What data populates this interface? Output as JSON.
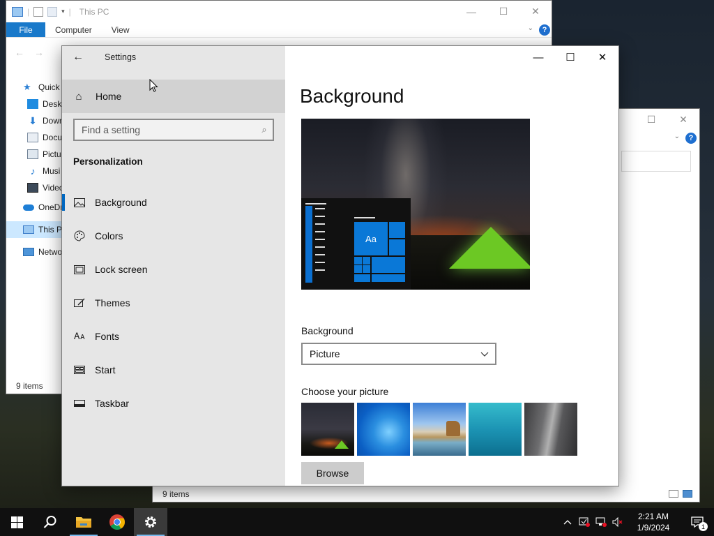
{
  "explorer1": {
    "title": "This PC",
    "ribbon": [
      "File",
      "Computer",
      "View"
    ],
    "tree": [
      {
        "label": "Quick",
        "icon": "star-icon",
        "sub": false
      },
      {
        "label": "Deskt",
        "icon": "desktop-folder-icon",
        "sub": true
      },
      {
        "label": "Down",
        "icon": "download-icon",
        "sub": true
      },
      {
        "label": "Docu",
        "icon": "document-icon",
        "sub": true
      },
      {
        "label": "Pictu",
        "icon": "pictures-icon",
        "sub": true
      },
      {
        "label": "Musi",
        "icon": "music-icon",
        "sub": true
      },
      {
        "label": "Video",
        "icon": "video-icon",
        "sub": true
      },
      {
        "label": "OneDr",
        "icon": "cloud-icon",
        "sub": false
      },
      {
        "label": "This PC",
        "icon": "computer-icon",
        "sub": false
      },
      {
        "label": "Netwo",
        "icon": "network-icon",
        "sub": false
      }
    ],
    "status": "9 items"
  },
  "explorer2": {
    "status": "9 items"
  },
  "settings": {
    "app_title": "Settings",
    "home_label": "Home",
    "search_placeholder": "Find a setting",
    "section_title": "Personalization",
    "nav": [
      {
        "label": "Background",
        "icon": "picture-icon"
      },
      {
        "label": "Colors",
        "icon": "palette-icon"
      },
      {
        "label": "Lock screen",
        "icon": "lock-screen-icon"
      },
      {
        "label": "Themes",
        "icon": "brush-icon"
      },
      {
        "label": "Fonts",
        "icon": "font-icon"
      },
      {
        "label": "Start",
        "icon": "start-layout-icon"
      },
      {
        "label": "Taskbar",
        "icon": "taskbar-icon"
      }
    ],
    "active_nav": "Background",
    "page_title": "Background",
    "preview_tile_text": "Aa",
    "background_label": "Background",
    "background_value": "Picture",
    "choose_label": "Choose your picture",
    "browse_label": "Browse",
    "accent_color": "#0078d7"
  },
  "taskbar": {
    "apps": [
      "start",
      "search",
      "file-explorer",
      "chrome",
      "settings"
    ],
    "time": "2:21 AM",
    "date": "1/9/2024",
    "notification_count": "1"
  }
}
